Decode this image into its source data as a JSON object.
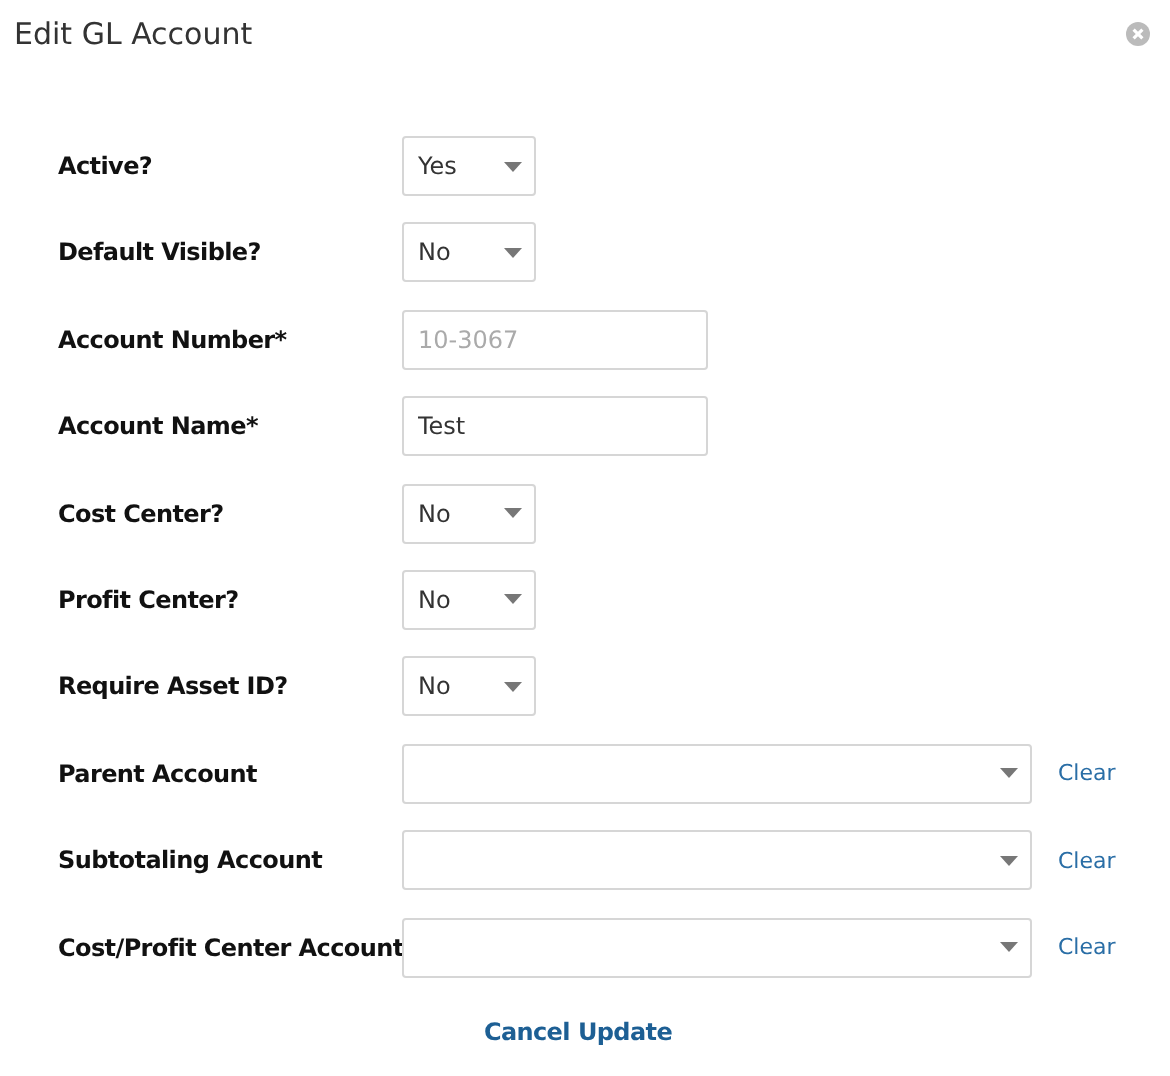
{
  "dialog": {
    "title": "Edit GL Account"
  },
  "fields": [
    {
      "kind": "select",
      "label": "Active?",
      "value": "Yes"
    },
    {
      "kind": "select",
      "label": "Default Visible?",
      "value": "No"
    },
    {
      "kind": "text",
      "label": "Account Number*",
      "value": "10-3067",
      "disabled": true
    },
    {
      "kind": "text",
      "label": "Account Name*",
      "value": "Test",
      "disabled": false
    },
    {
      "kind": "select",
      "label": "Cost Center?",
      "value": "No"
    },
    {
      "kind": "select",
      "label": "Profit Center?",
      "value": "No"
    },
    {
      "kind": "select",
      "label": "Require Asset ID?",
      "value": "No"
    },
    {
      "kind": "combo",
      "label": "Parent Account",
      "clear": "Clear"
    },
    {
      "kind": "combo",
      "label": "Subtotaling Account",
      "clear": "Clear"
    },
    {
      "kind": "combo",
      "label": "Cost/Profit Center Account",
      "clear": "Clear"
    }
  ],
  "actions": [
    "Cancel",
    "Update"
  ]
}
